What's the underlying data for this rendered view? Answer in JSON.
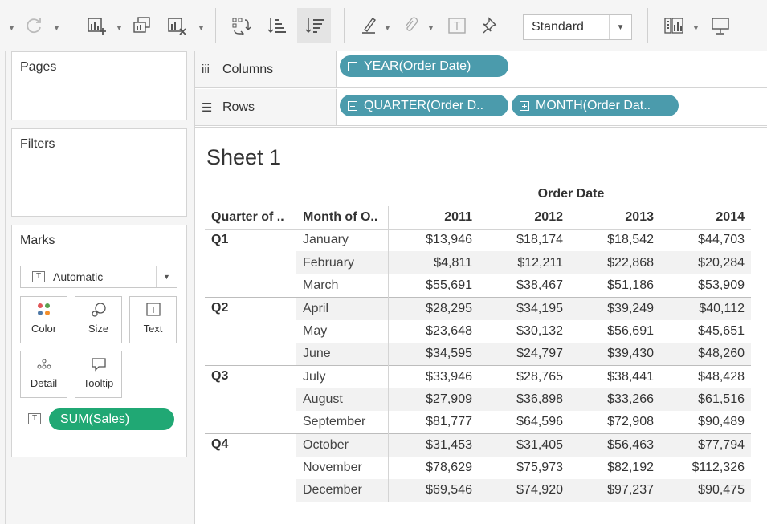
{
  "toolbar": {
    "style_select": "Standard",
    "text_tool_glyph": "T"
  },
  "panels": {
    "pages": "Pages",
    "filters": "Filters",
    "marks": "Marks"
  },
  "marks": {
    "type_icon": "T",
    "type": "Automatic",
    "buttons": {
      "color": "Color",
      "size": "Size",
      "text": "Text",
      "detail": "Detail",
      "tooltip": "Tooltip"
    },
    "text_icon": "T",
    "pill_icon": "T",
    "pill": "SUM(Sales)"
  },
  "shelves": {
    "columns": {
      "icon": "iii",
      "label": "Columns",
      "pills": [
        "YEAR(Order Date)"
      ]
    },
    "rows": {
      "icon": "☰",
      "label": "Rows",
      "pills": [
        "QUARTER(Order D..",
        "MONTH(Order Dat.."
      ]
    }
  },
  "sheet": {
    "title": "Sheet 1",
    "column_dimension": "Order Date",
    "headers": [
      "Quarter of ..",
      "Month of O..",
      "2011",
      "2012",
      "2013",
      "2014"
    ],
    "rows": [
      {
        "quarter": "Q1",
        "month": "January",
        "values": [
          "$13,946",
          "$18,174",
          "$18,542",
          "$44,703"
        ]
      },
      {
        "quarter": "",
        "month": "February",
        "values": [
          "$4,811",
          "$12,211",
          "$22,868",
          "$20,284"
        ]
      },
      {
        "quarter": "",
        "month": "March",
        "values": [
          "$55,691",
          "$38,467",
          "$51,186",
          "$53,909"
        ]
      },
      {
        "quarter": "Q2",
        "month": "April",
        "values": [
          "$28,295",
          "$34,195",
          "$39,249",
          "$40,112"
        ]
      },
      {
        "quarter": "",
        "month": "May",
        "values": [
          "$23,648",
          "$30,132",
          "$56,691",
          "$45,651"
        ]
      },
      {
        "quarter": "",
        "month": "June",
        "values": [
          "$34,595",
          "$24,797",
          "$39,430",
          "$48,260"
        ]
      },
      {
        "quarter": "Q3",
        "month": "July",
        "values": [
          "$33,946",
          "$28,765",
          "$38,441",
          "$48,428"
        ]
      },
      {
        "quarter": "",
        "month": "August",
        "values": [
          "$27,909",
          "$36,898",
          "$33,266",
          "$61,516"
        ]
      },
      {
        "quarter": "",
        "month": "September",
        "values": [
          "$81,777",
          "$64,596",
          "$72,908",
          "$90,489"
        ]
      },
      {
        "quarter": "Q4",
        "month": "October",
        "values": [
          "$31,453",
          "$31,405",
          "$56,463",
          "$77,794"
        ]
      },
      {
        "quarter": "",
        "month": "November",
        "values": [
          "$78,629",
          "$75,973",
          "$82,192",
          "$112,326"
        ]
      },
      {
        "quarter": "",
        "month": "December",
        "values": [
          "$69,546",
          "$74,920",
          "$97,237",
          "$90,475"
        ]
      }
    ]
  },
  "colors": {
    "pill_dimension": "#4b9bac",
    "pill_measure": "#20a874"
  }
}
